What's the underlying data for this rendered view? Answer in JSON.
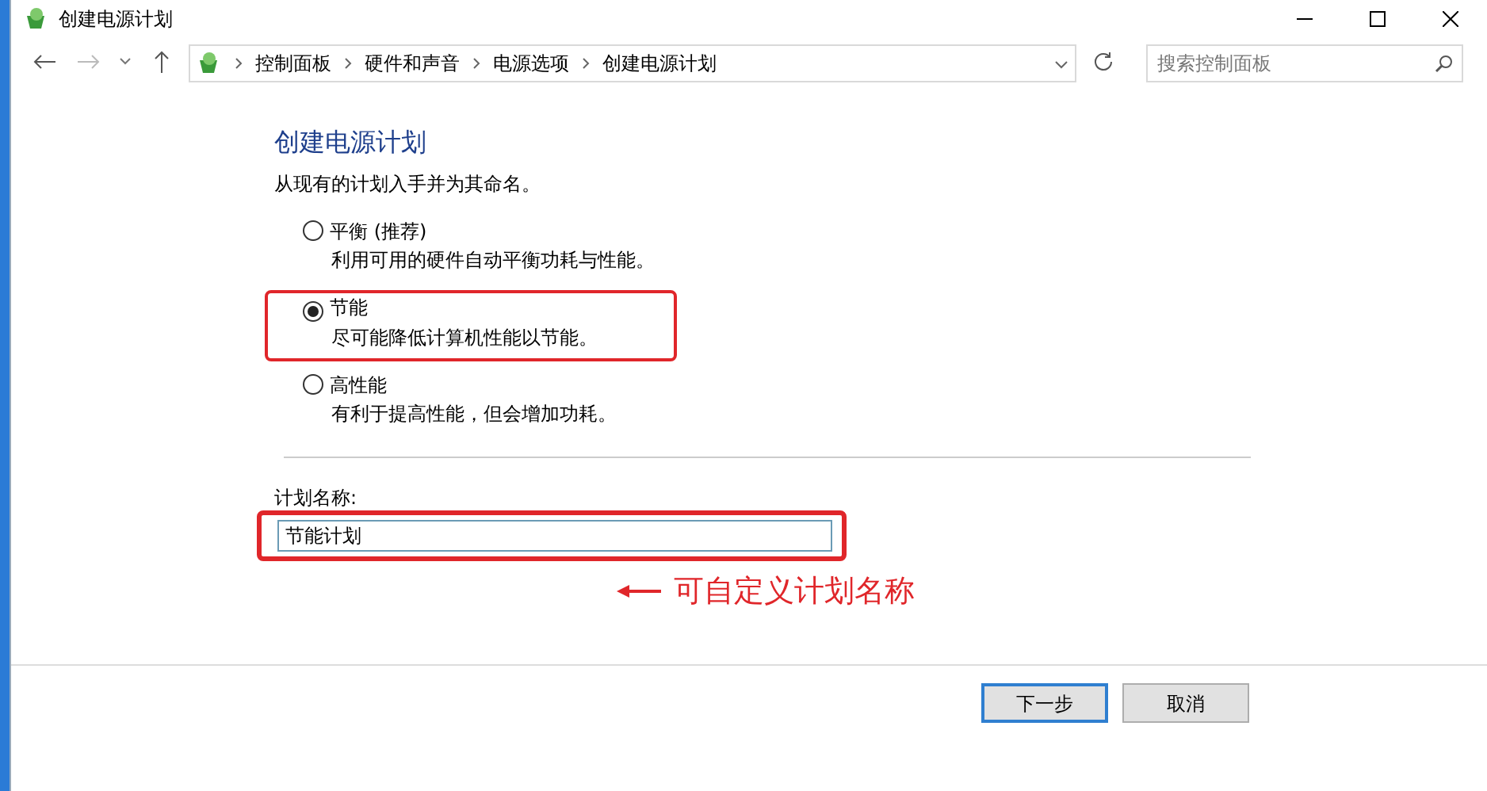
{
  "window": {
    "title": "创建电源计划"
  },
  "address_bar": {
    "breadcrumbs": [
      "控制面板",
      "硬件和声音",
      "电源选项",
      "创建电源计划"
    ]
  },
  "search": {
    "placeholder": "搜索控制面板"
  },
  "heading": "创建电源计划",
  "instruction": "从现有的计划入手并为其命名。",
  "plans": [
    {
      "label": "平衡 (推荐)",
      "description": "利用可用的硬件自动平衡功耗与性能。",
      "selected": false,
      "highlighted": false
    },
    {
      "label": "节能",
      "description": "尽可能降低计算机性能以节能。",
      "selected": true,
      "highlighted": true
    },
    {
      "label": "高性能",
      "description": "有利于提高性能，但会增加功耗。",
      "selected": false,
      "highlighted": false
    }
  ],
  "plan_name": {
    "label": "计划名称:",
    "value": "节能计划",
    "highlighted": true
  },
  "annotation": {
    "text": "可自定义计划名称"
  },
  "buttons": [
    {
      "label": "下一步",
      "default": true
    },
    {
      "label": "取消",
      "default": false
    }
  ]
}
